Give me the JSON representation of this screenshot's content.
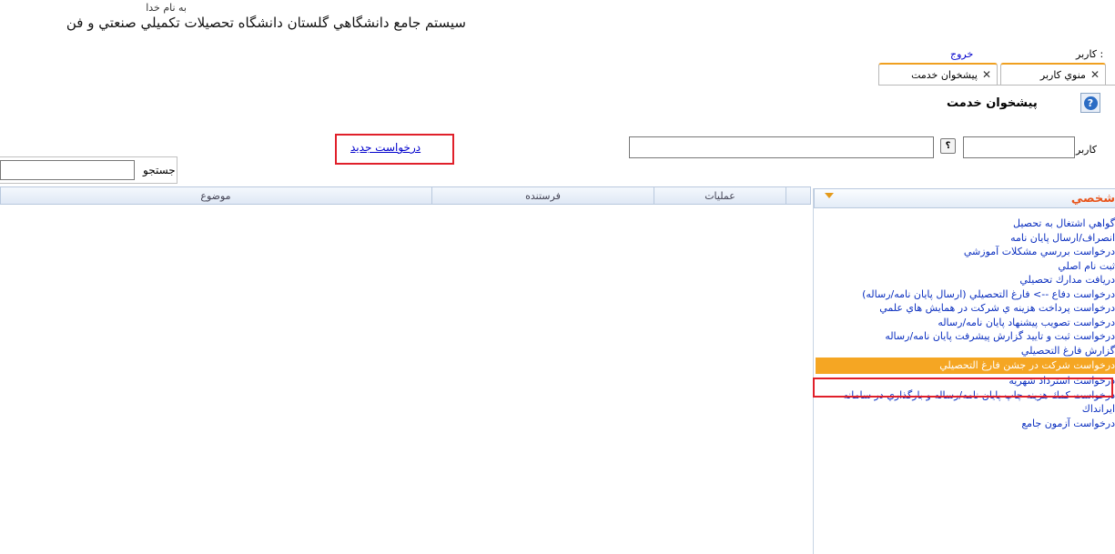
{
  "header": {
    "bismillah": "به نام خدا",
    "title": "سيستم جامع دانشگاهي گلستان   دانشگاه تحصيلات تكميلي صنعتي و فن"
  },
  "top": {
    "user_label": "كاربر :",
    "logout": "خروج"
  },
  "tabs": [
    {
      "label": "منوي كاربر",
      "close": "✕"
    },
    {
      "label": "پيشخوان خدمت",
      "close": "✕"
    }
  ],
  "page": {
    "help_icon": "?",
    "title": "پيشخوان خدمت"
  },
  "filter": {
    "user_label": "كاربر",
    "user_code_value": "",
    "user_help": "؟",
    "user_name_value": ""
  },
  "actions": {
    "new_request": "درخواست جديد"
  },
  "search": {
    "label": "جستجو",
    "value": ""
  },
  "grid": {
    "columns": [
      "موضوع",
      "فرستنده",
      "عمليات",
      ""
    ]
  },
  "sidebar": {
    "title": "شخصي",
    "toggle_icon": "chevron-down-icon",
    "selected_index": 11,
    "items": [
      "گواهي اشتغال به تحصيل",
      "انصراف/ارسال پايان نامه",
      "درخواست بررسي مشكلات آموزشي",
      "ثبت نام اصلي",
      "دريافت مدارك تحصيلي",
      "درخواست دفاع --> فارغ التحصيلي (ارسال پايان نامه/رساله)",
      "درخواست پرداخت هزينه ي شركت در همايش هاي علمي",
      "درخواست تصويب پيشنهاد پايان نامه/رساله",
      "درخواست ثبت و تاييد گزارش پيشرفت پايان نامه/رساله",
      "گزارش فارغ التحصيلي",
      "درخواست شركت در جشن فارغ التحصيلي",
      "درخواست استرداد شهريه",
      "درخواست كمك هزينه چاپ پايان نامه/رساله و بارگذاري در سامانه ايرانداك",
      "درخواست آزمون جامع"
    ]
  },
  "colors": {
    "accent": "#f5a623",
    "link": "#0b2fbf",
    "highlight_border": "#e0202a",
    "sidebar_title": "#e8541a"
  }
}
